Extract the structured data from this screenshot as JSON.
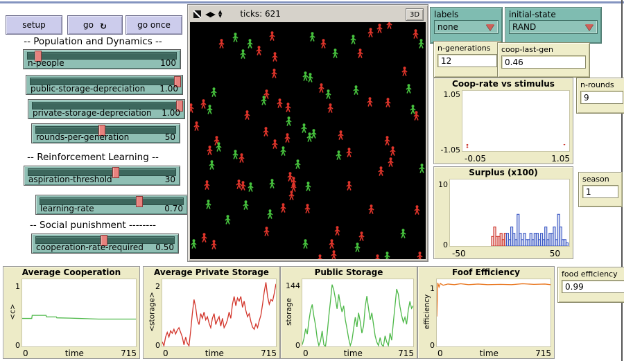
{
  "toolbar": {
    "setup": "setup",
    "go": "go",
    "go_once": "go once",
    "go_icon": "↻"
  },
  "section_headers": {
    "population": "-- Population and Dynamics --",
    "reinforcement": "-- Reinforcement Learning --",
    "social": "-- Social punishment --------"
  },
  "sliders": [
    {
      "label": "n-people",
      "value": "100",
      "pos": 0.09
    },
    {
      "label": "public-storage-depreciation",
      "value": "1.00",
      "pos": 0.965
    },
    {
      "label": "private-storage-depreciation",
      "value": "1.00",
      "pos": 0.965
    },
    {
      "label": "rounds-per-generation",
      "value": "50",
      "pos": 0.47
    },
    {
      "label": "aspiration-threshold",
      "value": "30",
      "pos": 0.585
    },
    {
      "label": "learning-rate",
      "value": "0.70",
      "pos": 0.68
    },
    {
      "label": "cooperation-rate-required",
      "value": "0.50",
      "pos": 0.49
    }
  ],
  "view": {
    "ticks_label": "ticks: 621",
    "threed_label": "3D",
    "agent_colors": {
      "r": "#e0352b",
      "g": "#47c33e"
    },
    "agents": [
      [
        65,
        21,
        "g"
      ],
      [
        45,
        30,
        "r"
      ],
      [
        86,
        30,
        "g"
      ],
      [
        118,
        19,
        "r"
      ],
      [
        176,
        20,
        "g"
      ],
      [
        192,
        30,
        "r"
      ],
      [
        235,
        24,
        "g"
      ],
      [
        260,
        14,
        "r"
      ],
      [
        273,
        8,
        "r"
      ],
      [
        325,
        16,
        "r"
      ],
      [
        333,
        30,
        "g"
      ],
      [
        99,
        40,
        "r"
      ],
      [
        76,
        45,
        "g"
      ],
      [
        122,
        49,
        "r"
      ],
      [
        209,
        44,
        "g"
      ],
      [
        245,
        44,
        "r"
      ],
      [
        121,
        73,
        "r"
      ],
      [
        166,
        77,
        "g"
      ],
      [
        173,
        79,
        "g"
      ],
      [
        189,
        94,
        "r"
      ],
      [
        199,
        103,
        "g"
      ],
      [
        239,
        97,
        "g"
      ],
      [
        259,
        114,
        "r"
      ],
      [
        285,
        115,
        "r"
      ],
      [
        34,
        100,
        "g"
      ],
      [
        110,
        103,
        "r"
      ],
      [
        106,
        112,
        "g"
      ],
      [
        19,
        117,
        "r"
      ],
      [
        1,
        123,
        "r"
      ],
      [
        28,
        125,
        "g"
      ],
      [
        129,
        116,
        "r"
      ],
      [
        141,
        122,
        "r"
      ],
      [
        202,
        123,
        "r"
      ],
      [
        321,
        125,
        "g"
      ],
      [
        326,
        134,
        "r"
      ],
      [
        309,
        70,
        "r"
      ],
      [
        315,
        95,
        "g"
      ],
      [
        82,
        133,
        "r"
      ],
      [
        142,
        142,
        "g"
      ],
      [
        109,
        157,
        "r"
      ],
      [
        164,
        152,
        "g"
      ],
      [
        9,
        149,
        "r"
      ],
      [
        38,
        170,
        "r"
      ],
      [
        172,
        165,
        "g"
      ],
      [
        178,
        160,
        "g"
      ],
      [
        140,
        166,
        "r"
      ],
      [
        217,
        162,
        "r"
      ],
      [
        284,
        170,
        "r"
      ],
      [
        287,
        2,
        "r"
      ],
      [
        28,
        184,
        "r"
      ],
      [
        41,
        179,
        "g"
      ],
      [
        122,
        175,
        "r"
      ],
      [
        134,
        185,
        "g"
      ],
      [
        65,
        190,
        "g"
      ],
      [
        74,
        195,
        "r"
      ],
      [
        214,
        191,
        "g"
      ],
      [
        229,
        187,
        "r"
      ],
      [
        292,
        185,
        "r"
      ],
      [
        289,
        201,
        "r"
      ],
      [
        31,
        205,
        "g"
      ],
      [
        275,
        214,
        "r"
      ],
      [
        334,
        210,
        "g"
      ],
      [
        155,
        204,
        "g"
      ],
      [
        24,
        234,
        "r"
      ],
      [
        70,
        233,
        "r"
      ],
      [
        76,
        235,
        "r"
      ],
      [
        87,
        237,
        "g"
      ],
      [
        118,
        232,
        "g"
      ],
      [
        144,
        222,
        "r"
      ],
      [
        149,
        229,
        "r"
      ],
      [
        149,
        237,
        "r"
      ],
      [
        170,
        236,
        "g"
      ],
      [
        229,
        235,
        "r"
      ],
      [
        146,
        249,
        "r"
      ],
      [
        26,
        262,
        "g"
      ],
      [
        80,
        263,
        "g"
      ],
      [
        134,
        267,
        "r"
      ],
      [
        169,
        268,
        "r"
      ],
      [
        261,
        269,
        "r"
      ],
      [
        327,
        270,
        "r"
      ],
      [
        115,
        276,
        "g"
      ],
      [
        54,
        284,
        "g"
      ],
      [
        110,
        301,
        "r"
      ],
      [
        212,
        300,
        "r"
      ],
      [
        247,
        308,
        "r"
      ],
      [
        307,
        304,
        "g"
      ],
      [
        20,
        310,
        "r"
      ],
      [
        5,
        319,
        "g"
      ],
      [
        34,
        320,
        "r"
      ],
      [
        166,
        319,
        "g"
      ],
      [
        204,
        319,
        "r"
      ],
      [
        241,
        324,
        "g"
      ],
      [
        207,
        335,
        "r"
      ],
      [
        270,
        341,
        "r"
      ],
      [
        284,
        337,
        "g"
      ],
      [
        331,
        337,
        "r"
      ],
      [
        187,
        341,
        "r"
      ]
    ]
  },
  "choosers": [
    {
      "label": "labels",
      "value": "none"
    },
    {
      "label": "initial-state",
      "value": "RAND"
    }
  ],
  "monitors": [
    {
      "label": "n-generations",
      "value": "12"
    },
    {
      "label": "coop-last-gen",
      "value": "0.46"
    },
    {
      "label": "n-rounds",
      "value": "9"
    },
    {
      "label": "season",
      "value": "1"
    },
    {
      "label": "food efficiency",
      "value": "0.99"
    }
  ],
  "chart_data": [
    {
      "name": "coop-rate-vs-stimulus",
      "type": "scatter",
      "title": "Coop-rate vs stimulus",
      "xlim": [
        -0.05,
        1.05
      ],
      "ylim": [
        -1.12,
        1.12
      ],
      "x_ticks": [
        "-0.05",
        "1.05"
      ],
      "y_ticks": [
        "1.05",
        "-1.05"
      ],
      "grid": false,
      "series": [
        {
          "name": "pen-default",
          "type": "scatter",
          "color": "#cc3228",
          "points": [
            [
              0.0,
              -0.88
            ],
            [
              0.0,
              -0.93
            ],
            [
              0.0,
              -0.98
            ],
            [
              1.0,
              -0.88
            ]
          ]
        }
      ]
    },
    {
      "name": "surplus-x100",
      "type": "bar",
      "title": "Surplus (x100)",
      "xlim": [
        -52,
        60
      ],
      "ylim": [
        0,
        10.5
      ],
      "x_ticks": [
        "-50",
        "50"
      ],
      "y_ticks": [
        "10",
        "0"
      ],
      "grid": false,
      "series": [
        {
          "name": "deficit",
          "type": "bars",
          "color": "#cc3228",
          "x0": -13,
          "bw": 2,
          "v": [
            1.5,
            3,
            1.5,
            1.5,
            2,
            1,
            2
          ]
        },
        {
          "name": "surplus",
          "type": "bars",
          "color": "#3a57c4",
          "x0": 1,
          "bw": 2,
          "v": [
            2,
            1,
            3,
            2,
            1,
            5,
            2,
            1,
            2,
            1,
            1,
            2,
            1,
            2,
            2,
            1,
            2,
            1,
            3,
            1,
            2,
            2,
            3,
            1,
            5,
            3,
            1,
            1,
            0.5
          ]
        }
      ]
    },
    {
      "name": "average-cooperation",
      "type": "line",
      "title": "Average Cooperation",
      "xlabel": "time",
      "ylabel": "<c>",
      "xlim": [
        0,
        715
      ],
      "ylim": [
        0,
        1.08
      ],
      "x_ticks": [
        "0",
        "time",
        "715"
      ],
      "y_ticks": [
        "1",
        "0"
      ],
      "grid": false,
      "series": [
        {
          "name": "<c>",
          "type": "line",
          "color": "#4db848",
          "points": [
            [
              0,
              0.45
            ],
            [
              60,
              0.45
            ],
            [
              63,
              0.5
            ],
            [
              150,
              0.5
            ],
            [
              153,
              0.475
            ],
            [
              215,
              0.475
            ],
            [
              218,
              0.46
            ],
            [
              300,
              0.455
            ],
            [
              360,
              0.45
            ],
            [
              480,
              0.44
            ],
            [
              715,
              0.44
            ]
          ]
        }
      ]
    },
    {
      "name": "average-private-storage",
      "type": "line",
      "title": "Average Private Storage",
      "xlabel": "time",
      "ylabel": "<storage>",
      "xlim": [
        0,
        715
      ],
      "ylim": [
        0,
        2.15
      ],
      "x_ticks": [
        "0",
        "time",
        "715"
      ],
      "y_ticks": [
        "2",
        "0"
      ],
      "grid": false,
      "series": [
        {
          "name": "<storage>",
          "type": "line",
          "color": "#d2342a",
          "v": [
            0.15,
            0.02,
            0.3,
            0.45,
            0.3,
            0.5,
            0.42,
            0.55,
            0.4,
            0.52,
            0.6,
            0.45,
            0.3,
            0.05,
            0.3,
            0.1,
            0.02,
            0.5,
            1.05,
            1.5,
            1.25,
            0.85,
            0.7,
            1.05,
            0.9,
            1.1,
            0.85,
            0.95,
            0.75,
            0.6,
            0.9,
            1.05,
            0.7,
            0.85,
            0.95,
            0.65,
            0.9,
            0.6,
            0.7,
            0.85,
            1.1,
            0.9,
            1.35,
            1.6,
            1.3,
            1.55,
            1.45,
            1.6,
            1.25,
            1.45,
            1.15,
            0.95,
            1.05,
            0.8,
            0.62,
            0.55,
            0.72,
            0.6,
            0.82,
            1.0,
            1.35,
            1.75,
            2.05,
            1.6,
            1.35,
            1.5,
            1.45,
            1.7,
            2.0
          ]
        }
      ]
    },
    {
      "name": "public-storage",
      "type": "line",
      "title": "Public Storage",
      "xlabel": "time",
      "ylabel": "storage",
      "xlim": [
        0,
        715
      ],
      "ylim": [
        0,
        152
      ],
      "x_ticks": [
        "0",
        "time",
        "715"
      ],
      "y_ticks": [
        "144",
        "0"
      ],
      "grid": false,
      "series": [
        {
          "name": "storage",
          "type": "line",
          "color": "#4db848",
          "v": [
            4,
            18,
            40,
            28,
            58,
            82,
            95,
            68,
            48,
            18,
            2,
            12,
            35,
            4,
            0,
            28,
            68,
            102,
            140,
            128,
            108,
            85,
            118,
            95,
            78,
            92,
            60,
            40,
            18,
            2,
            14,
            40,
            66,
            44,
            76,
            56,
            30,
            46,
            90,
            114,
            86,
            60,
            76,
            50,
            24,
            10,
            2,
            20,
            4,
            0,
            24,
            10,
            2,
            30,
            14,
            55,
            92,
            130,
            118,
            90,
            70,
            55,
            66,
            50,
            82,
            102,
            86,
            92
          ]
        }
      ]
    },
    {
      "name": "foof-efficiency",
      "type": "line",
      "title": "Foof Efficiency",
      "xlabel": "time",
      "ylabel": "efficiency",
      "xlim": [
        0,
        715
      ],
      "ylim": [
        0,
        1.12
      ],
      "x_ticks": [
        "0",
        "time",
        "715"
      ],
      "y_ticks": [
        "1",
        "0"
      ],
      "grid": false,
      "series": [
        {
          "name": "efficiency",
          "type": "line",
          "color": "#e8731a",
          "points": [
            [
              0,
              0.5
            ],
            [
              6,
              1.06
            ],
            [
              14,
              0.99
            ],
            [
              22,
              1.05
            ],
            [
              40,
              1.02
            ],
            [
              70,
              1.04
            ],
            [
              110,
              1.03
            ],
            [
              150,
              1.045
            ],
            [
              200,
              1.03
            ],
            [
              260,
              1.04
            ],
            [
              320,
              1.03
            ],
            [
              400,
              1.035
            ],
            [
              470,
              1.03
            ],
            [
              540,
              1.045
            ],
            [
              610,
              1.035
            ],
            [
              680,
              1.04
            ],
            [
              715,
              1.03
            ]
          ]
        }
      ]
    }
  ]
}
